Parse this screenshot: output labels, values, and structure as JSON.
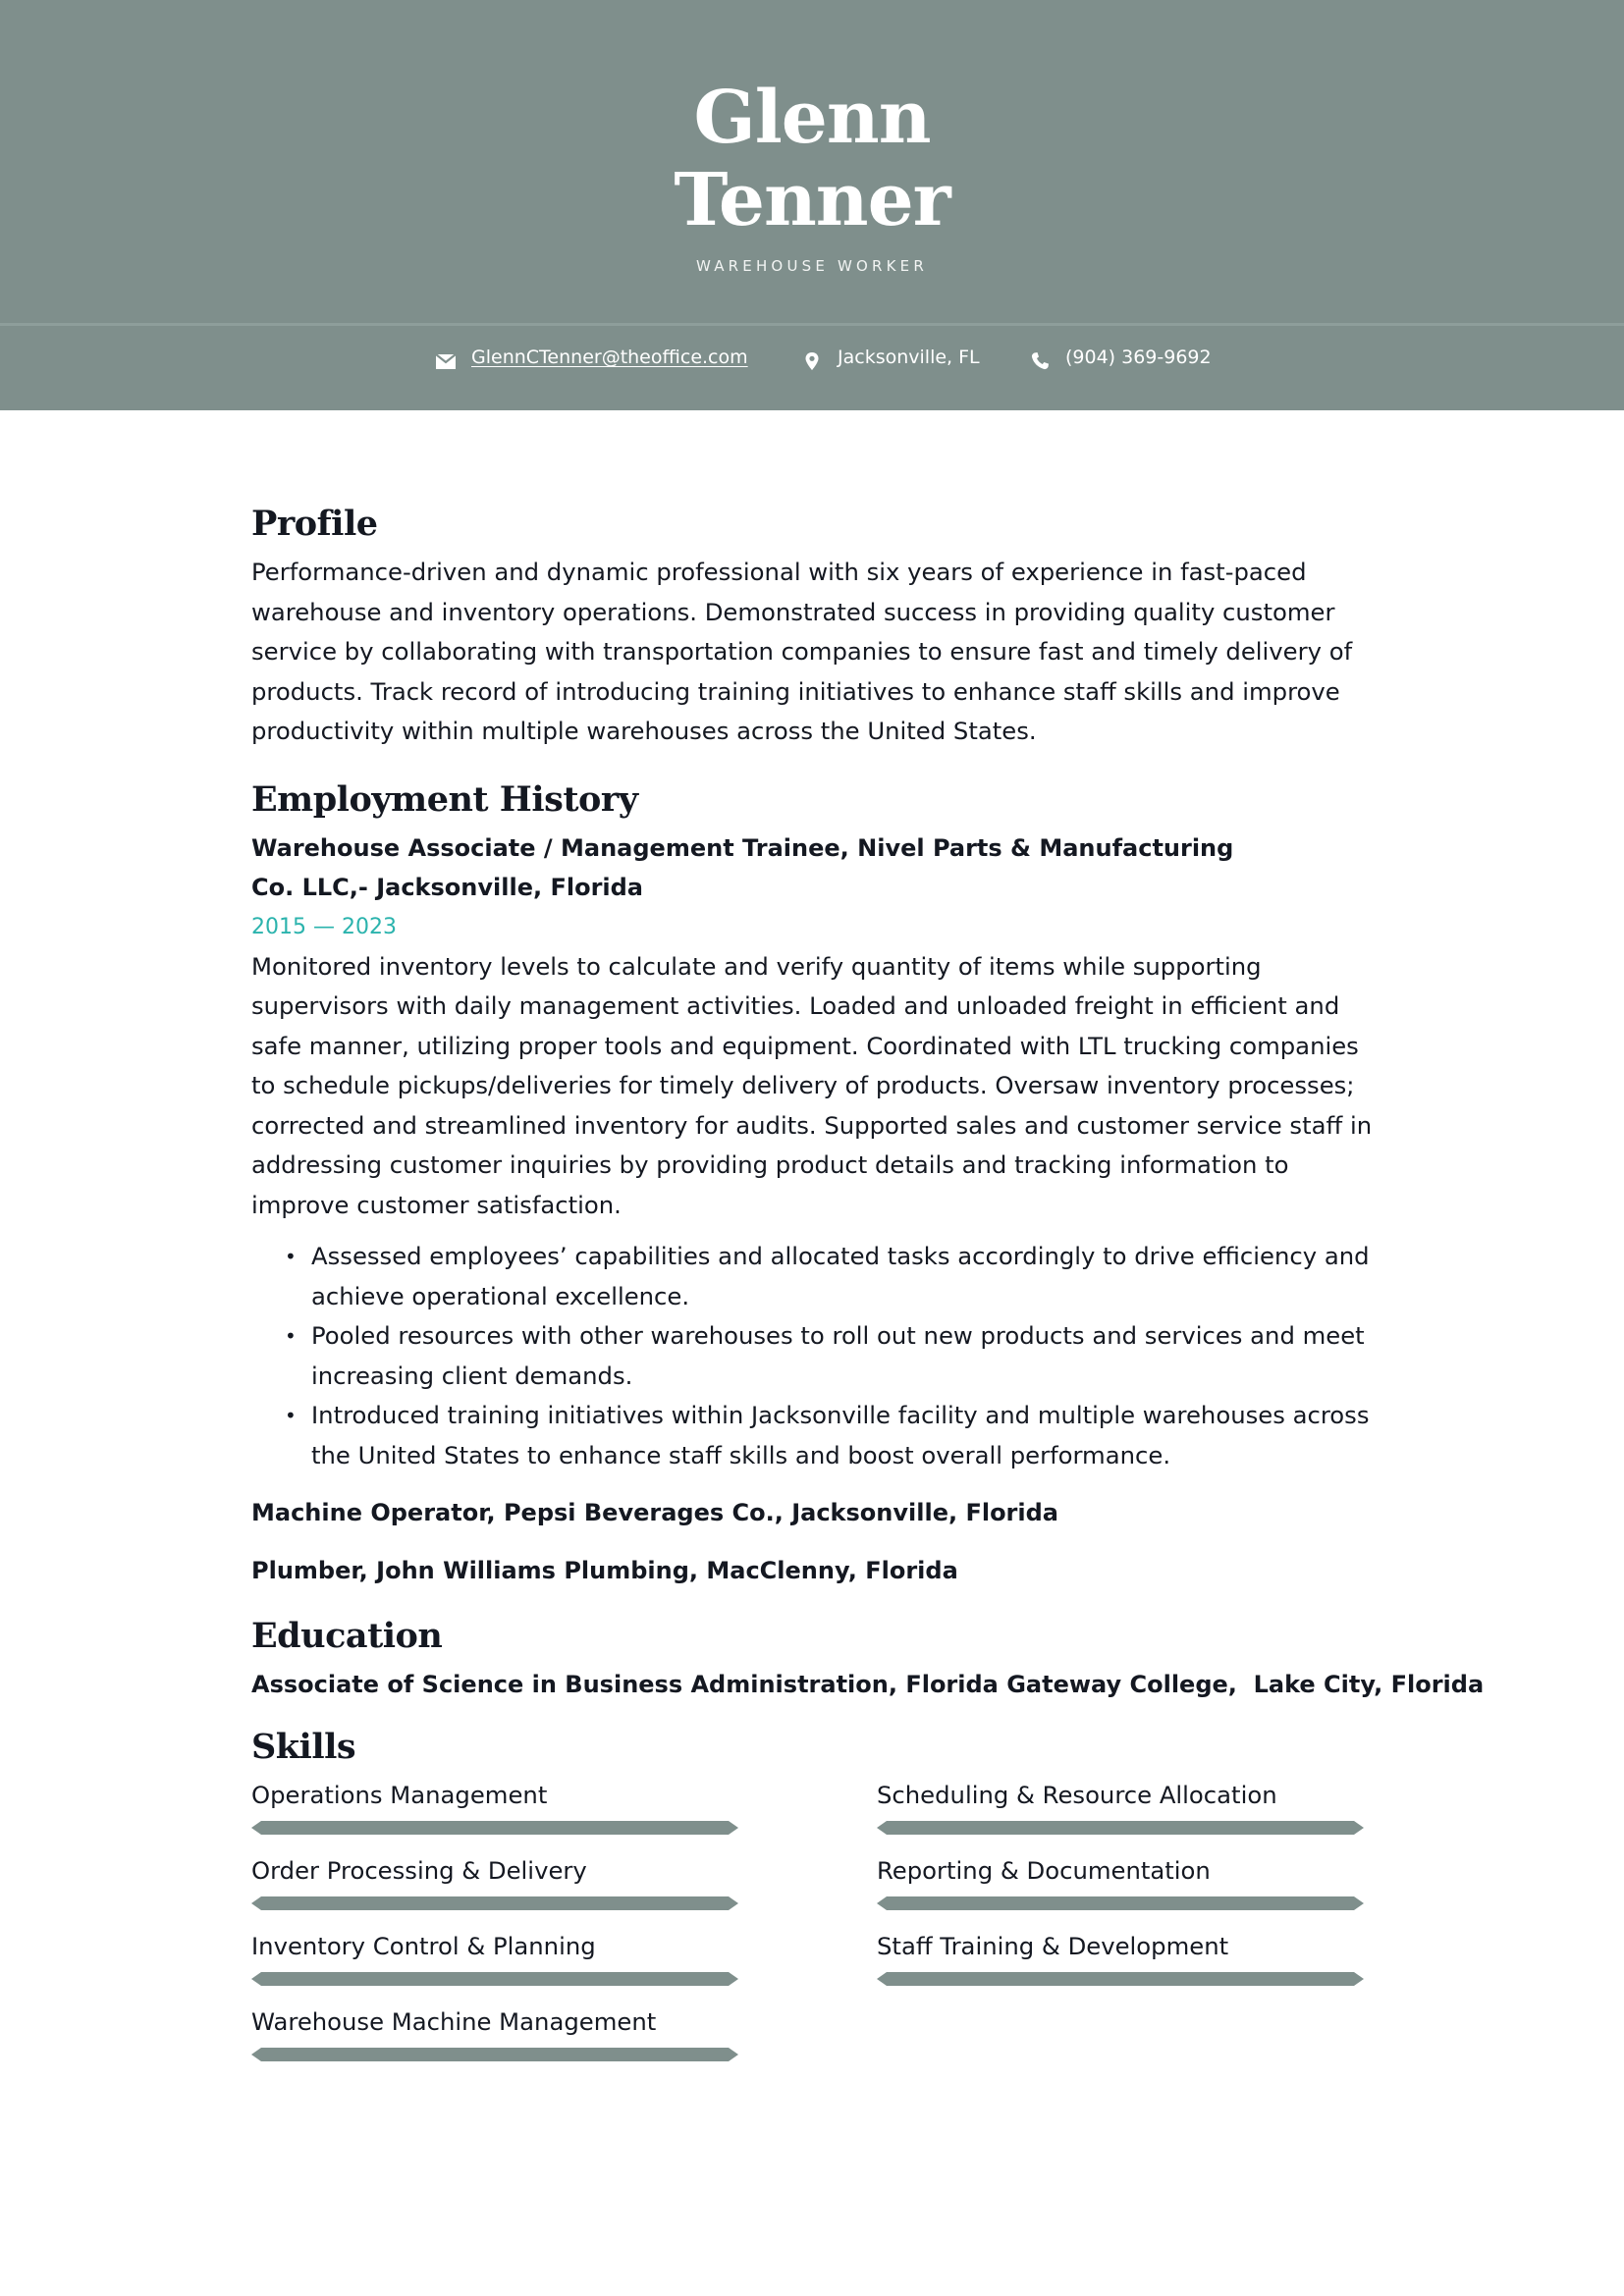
{
  "header": {
    "first_name": "Glenn",
    "last_name": "Tenner",
    "job_title": "WAREHOUSE WORKER",
    "background_color": "#7f8f8c",
    "contacts": {
      "email": {
        "icon": "envelope-icon",
        "text": "GlennCTenner@theoffice.com"
      },
      "location": {
        "icon": "map-pin-icon",
        "text": "Jacksonville, FL"
      },
      "phone": {
        "icon": "phone-icon",
        "text": "(904) 369-9692"
      }
    }
  },
  "profile": {
    "heading": "Profile",
    "text": "Performance-driven and dynamic professional with six years of experience in fast-paced warehouse and inventory operations. Demonstrated success in providing quality customer service by collaborating with transportation companies to ensure fast and timely delivery of products. Track record of introducing training initiatives to enhance staff skills and improve productivity within multiple warehouses across the United States."
  },
  "employment": {
    "heading": "Employment History",
    "jobs": [
      {
        "title": "Warehouse Associate / Management Trainee, Nivel Parts & Manufacturing Co. LLC,- Jacksonville, Florida",
        "dates": "2015 — 2023",
        "description": "Monitored inventory levels to calculate and verify quantity of items while supporting supervisors with daily management activities. Loaded and unloaded freight in efficient and safe manner, utilizing proper tools and equipment. Coordinated with LTL trucking companies to schedule pickups/deliveries for timely delivery of products. Oversaw inventory processes; corrected and streamlined inventory for audits. Supported sales and customer service staff in addressing customer inquiries by providing product details and tracking information to improve customer satisfaction.",
        "bullets": [
          "Assessed employees’ capabilities and allocated tasks accordingly to drive efficiency and achieve operational excellence.",
          "Pooled resources with other warehouses to roll out new products and services and meet increasing client demands.",
          "Introduced training initiatives within Jacksonville facility and multiple warehouses across the United States to enhance staff skills and boost overall performance."
        ]
      },
      {
        "title": "Machine Operator, Pepsi Beverages Co., Jacksonville, Florida"
      },
      {
        "title": "Plumber, John Williams Plumbing, MacClenny, Florida"
      }
    ],
    "date_color": "#2bb3ad"
  },
  "education": {
    "heading": "Education",
    "entries": [
      "Associate of Science in Business Administration, Florida Gateway College,  Lake City, Florida"
    ]
  },
  "skills": {
    "heading": "Skills",
    "bar_color": "#7f8f8c",
    "items": [
      {
        "label": "Operations Management",
        "level": 1.0
      },
      {
        "label": "Scheduling & Resource Allocation",
        "level": 1.0
      },
      {
        "label": "Order Processing & Delivery",
        "level": 1.0
      },
      {
        "label": "Reporting & Documentation",
        "level": 1.0
      },
      {
        "label": "Inventory Control & Planning",
        "level": 1.0
      },
      {
        "label": "Staff Training & Development",
        "level": 1.0
      },
      {
        "label": "Warehouse Machine Management",
        "level": 1.0
      }
    ]
  }
}
